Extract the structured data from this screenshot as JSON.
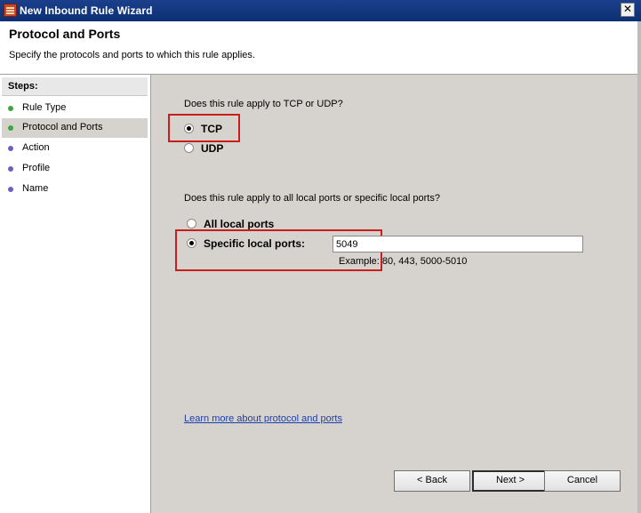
{
  "window": {
    "title": "New Inbound Rule Wizard",
    "close_glyph": "✕"
  },
  "header": {
    "title": "Protocol and Ports",
    "description": "Specify the protocols and ports to which this rule applies."
  },
  "steps": {
    "heading": "Steps:",
    "items": [
      {
        "label": "Rule Type",
        "status": "done",
        "color": "#3ca53c"
      },
      {
        "label": "Protocol and Ports",
        "status": "current",
        "color": "#3ca53c"
      },
      {
        "label": "Action",
        "status": "pending",
        "color": "#6b5fc0"
      },
      {
        "label": "Profile",
        "status": "pending",
        "color": "#6b5fc0"
      },
      {
        "label": "Name",
        "status": "pending",
        "color": "#6b5fc0"
      }
    ]
  },
  "protocol": {
    "question": "Does this rule apply to TCP or UDP?",
    "options": [
      {
        "label": "TCP",
        "checked": true
      },
      {
        "label": "UDP",
        "checked": false
      }
    ]
  },
  "ports": {
    "question": "Does this rule apply to all local ports or specific local ports?",
    "all_label": "All local ports",
    "all_checked": false,
    "specific_label": "Specific local ports:",
    "specific_checked": true,
    "value": "5049",
    "example": "Example: 80, 443, 5000-5010"
  },
  "link": {
    "text": "Learn more about protocol and ports"
  },
  "buttons": {
    "back": "< Back",
    "next": "Next >",
    "cancel": "Cancel"
  },
  "highlight_color": "#c81e1e"
}
